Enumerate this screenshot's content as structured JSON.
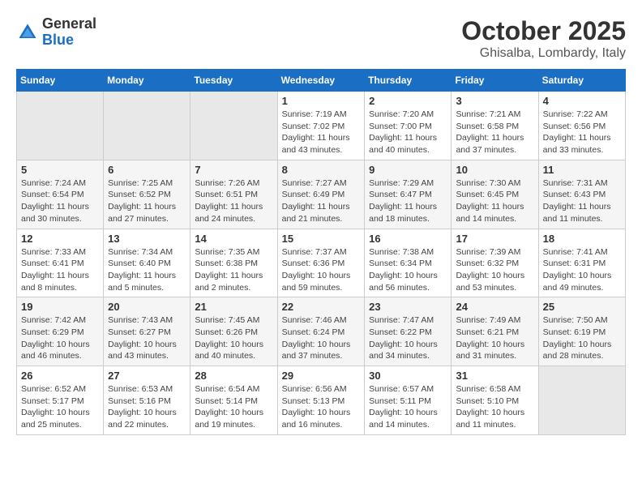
{
  "header": {
    "logo": {
      "general": "General",
      "blue": "Blue"
    },
    "title": "October 2025",
    "location": "Ghisalba, Lombardy, Italy"
  },
  "calendar": {
    "days_of_week": [
      "Sunday",
      "Monday",
      "Tuesday",
      "Wednesday",
      "Thursday",
      "Friday",
      "Saturday"
    ],
    "weeks": [
      [
        {
          "day": "",
          "sunrise": "",
          "sunset": "",
          "daylight": ""
        },
        {
          "day": "",
          "sunrise": "",
          "sunset": "",
          "daylight": ""
        },
        {
          "day": "",
          "sunrise": "",
          "sunset": "",
          "daylight": ""
        },
        {
          "day": "1",
          "sunrise": "Sunrise: 7:19 AM",
          "sunset": "Sunset: 7:02 PM",
          "daylight": "Daylight: 11 hours and 43 minutes."
        },
        {
          "day": "2",
          "sunrise": "Sunrise: 7:20 AM",
          "sunset": "Sunset: 7:00 PM",
          "daylight": "Daylight: 11 hours and 40 minutes."
        },
        {
          "day": "3",
          "sunrise": "Sunrise: 7:21 AM",
          "sunset": "Sunset: 6:58 PM",
          "daylight": "Daylight: 11 hours and 37 minutes."
        },
        {
          "day": "4",
          "sunrise": "Sunrise: 7:22 AM",
          "sunset": "Sunset: 6:56 PM",
          "daylight": "Daylight: 11 hours and 33 minutes."
        }
      ],
      [
        {
          "day": "5",
          "sunrise": "Sunrise: 7:24 AM",
          "sunset": "Sunset: 6:54 PM",
          "daylight": "Daylight: 11 hours and 30 minutes."
        },
        {
          "day": "6",
          "sunrise": "Sunrise: 7:25 AM",
          "sunset": "Sunset: 6:52 PM",
          "daylight": "Daylight: 11 hours and 27 minutes."
        },
        {
          "day": "7",
          "sunrise": "Sunrise: 7:26 AM",
          "sunset": "Sunset: 6:51 PM",
          "daylight": "Daylight: 11 hours and 24 minutes."
        },
        {
          "day": "8",
          "sunrise": "Sunrise: 7:27 AM",
          "sunset": "Sunset: 6:49 PM",
          "daylight": "Daylight: 11 hours and 21 minutes."
        },
        {
          "day": "9",
          "sunrise": "Sunrise: 7:29 AM",
          "sunset": "Sunset: 6:47 PM",
          "daylight": "Daylight: 11 hours and 18 minutes."
        },
        {
          "day": "10",
          "sunrise": "Sunrise: 7:30 AM",
          "sunset": "Sunset: 6:45 PM",
          "daylight": "Daylight: 11 hours and 14 minutes."
        },
        {
          "day": "11",
          "sunrise": "Sunrise: 7:31 AM",
          "sunset": "Sunset: 6:43 PM",
          "daylight": "Daylight: 11 hours and 11 minutes."
        }
      ],
      [
        {
          "day": "12",
          "sunrise": "Sunrise: 7:33 AM",
          "sunset": "Sunset: 6:41 PM",
          "daylight": "Daylight: 11 hours and 8 minutes."
        },
        {
          "day": "13",
          "sunrise": "Sunrise: 7:34 AM",
          "sunset": "Sunset: 6:40 PM",
          "daylight": "Daylight: 11 hours and 5 minutes."
        },
        {
          "day": "14",
          "sunrise": "Sunrise: 7:35 AM",
          "sunset": "Sunset: 6:38 PM",
          "daylight": "Daylight: 11 hours and 2 minutes."
        },
        {
          "day": "15",
          "sunrise": "Sunrise: 7:37 AM",
          "sunset": "Sunset: 6:36 PM",
          "daylight": "Daylight: 10 hours and 59 minutes."
        },
        {
          "day": "16",
          "sunrise": "Sunrise: 7:38 AM",
          "sunset": "Sunset: 6:34 PM",
          "daylight": "Daylight: 10 hours and 56 minutes."
        },
        {
          "day": "17",
          "sunrise": "Sunrise: 7:39 AM",
          "sunset": "Sunset: 6:32 PM",
          "daylight": "Daylight: 10 hours and 53 minutes."
        },
        {
          "day": "18",
          "sunrise": "Sunrise: 7:41 AM",
          "sunset": "Sunset: 6:31 PM",
          "daylight": "Daylight: 10 hours and 49 minutes."
        }
      ],
      [
        {
          "day": "19",
          "sunrise": "Sunrise: 7:42 AM",
          "sunset": "Sunset: 6:29 PM",
          "daylight": "Daylight: 10 hours and 46 minutes."
        },
        {
          "day": "20",
          "sunrise": "Sunrise: 7:43 AM",
          "sunset": "Sunset: 6:27 PM",
          "daylight": "Daylight: 10 hours and 43 minutes."
        },
        {
          "day": "21",
          "sunrise": "Sunrise: 7:45 AM",
          "sunset": "Sunset: 6:26 PM",
          "daylight": "Daylight: 10 hours and 40 minutes."
        },
        {
          "day": "22",
          "sunrise": "Sunrise: 7:46 AM",
          "sunset": "Sunset: 6:24 PM",
          "daylight": "Daylight: 10 hours and 37 minutes."
        },
        {
          "day": "23",
          "sunrise": "Sunrise: 7:47 AM",
          "sunset": "Sunset: 6:22 PM",
          "daylight": "Daylight: 10 hours and 34 minutes."
        },
        {
          "day": "24",
          "sunrise": "Sunrise: 7:49 AM",
          "sunset": "Sunset: 6:21 PM",
          "daylight": "Daylight: 10 hours and 31 minutes."
        },
        {
          "day": "25",
          "sunrise": "Sunrise: 7:50 AM",
          "sunset": "Sunset: 6:19 PM",
          "daylight": "Daylight: 10 hours and 28 minutes."
        }
      ],
      [
        {
          "day": "26",
          "sunrise": "Sunrise: 6:52 AM",
          "sunset": "Sunset: 5:17 PM",
          "daylight": "Daylight: 10 hours and 25 minutes."
        },
        {
          "day": "27",
          "sunrise": "Sunrise: 6:53 AM",
          "sunset": "Sunset: 5:16 PM",
          "daylight": "Daylight: 10 hours and 22 minutes."
        },
        {
          "day": "28",
          "sunrise": "Sunrise: 6:54 AM",
          "sunset": "Sunset: 5:14 PM",
          "daylight": "Daylight: 10 hours and 19 minutes."
        },
        {
          "day": "29",
          "sunrise": "Sunrise: 6:56 AM",
          "sunset": "Sunset: 5:13 PM",
          "daylight": "Daylight: 10 hours and 16 minutes."
        },
        {
          "day": "30",
          "sunrise": "Sunrise: 6:57 AM",
          "sunset": "Sunset: 5:11 PM",
          "daylight": "Daylight: 10 hours and 14 minutes."
        },
        {
          "day": "31",
          "sunrise": "Sunrise: 6:58 AM",
          "sunset": "Sunset: 5:10 PM",
          "daylight": "Daylight: 10 hours and 11 minutes."
        },
        {
          "day": "",
          "sunrise": "",
          "sunset": "",
          "daylight": ""
        }
      ]
    ]
  }
}
